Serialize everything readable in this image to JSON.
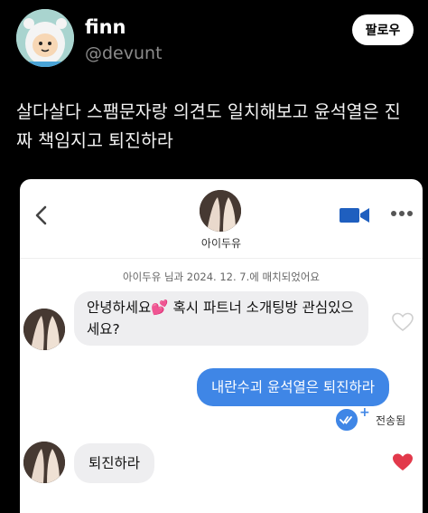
{
  "tweet": {
    "display_name": "finn",
    "handle": "@devunt",
    "follow_label": "팔로우",
    "text": "살다살다 스팸문자랑 의견도 일치해보고 윤석열은 진짜 책임지고 퇴진하라"
  },
  "chat": {
    "contact_name": "아이두유",
    "match_note": "아이두유 님과 2024. 12. 7.에 매치되었어요",
    "messages": [
      {
        "direction": "in",
        "text": "안녕하세요💕 혹시 파트너 소개팅방 관심있으세요?",
        "liked": false
      },
      {
        "direction": "out",
        "text": "내란수괴 윤석열은 퇴진하라",
        "status": "전송됨"
      },
      {
        "direction": "in",
        "text": "퇴진하라",
        "liked": true
      }
    ]
  },
  "colors": {
    "accent_blue": "#3f86e6",
    "heart_red": "#e2394b",
    "incoming_bubble": "#eeeef0"
  },
  "icons": [
    "back-icon",
    "video-call-icon",
    "more-options-icon",
    "heart-outline-icon",
    "heart-filled-icon",
    "sent-check-icon"
  ]
}
